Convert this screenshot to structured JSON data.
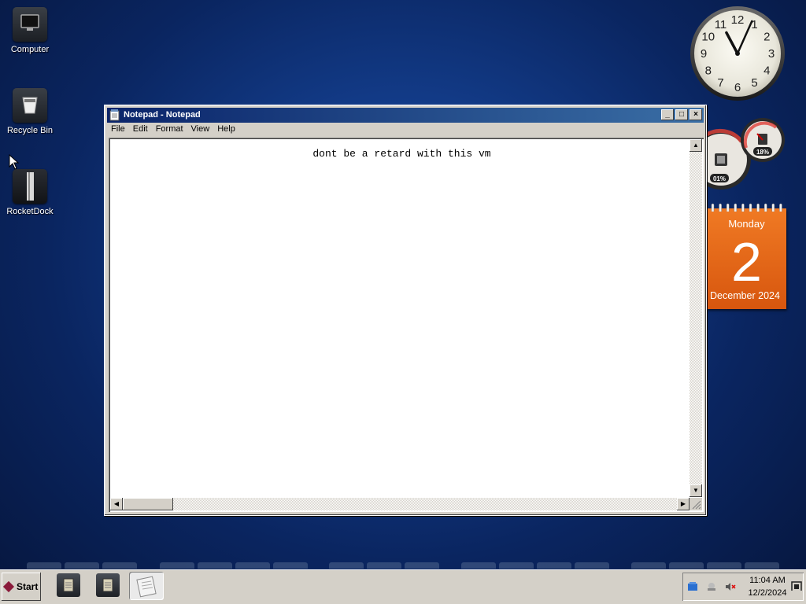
{
  "desktop": {
    "icons": [
      {
        "label": "Computer"
      },
      {
        "label": "Recycle Bin"
      },
      {
        "label": "RocketDock"
      }
    ]
  },
  "clock": {
    "numerals": [
      "12",
      "1",
      "2",
      "3",
      "4",
      "5",
      "6",
      "7",
      "8",
      "9",
      "10",
      "11"
    ],
    "time": "11:04"
  },
  "meter": {
    "cpu": "01%",
    "memory": "18%"
  },
  "calendar": {
    "weekday": "Monday",
    "day": "2",
    "month_year": "December 2024"
  },
  "window": {
    "title": "Notepad - Notepad",
    "menu": [
      "File",
      "Edit",
      "Format",
      "View",
      "Help"
    ],
    "content": "dont be a retard with this vm",
    "minimize_glyph": "_",
    "maximize_glyph": "□",
    "close_glyph": "×"
  },
  "taskbar": {
    "start_label": "Start",
    "time": "11:04 AM",
    "date": "12/2/2024"
  }
}
